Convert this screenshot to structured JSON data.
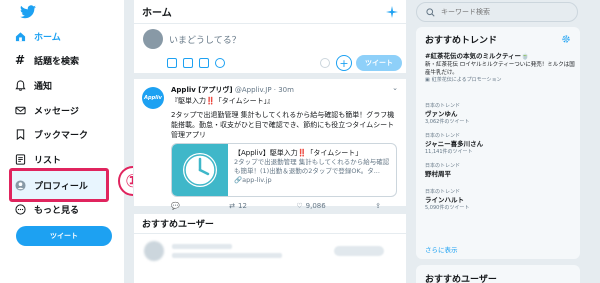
{
  "nav": {
    "items": [
      {
        "label": "ホーム",
        "icon": "home-icon"
      },
      {
        "label": "話題を検索",
        "icon": "hashtag-icon"
      },
      {
        "label": "通知",
        "icon": "bell-icon"
      },
      {
        "label": "メッセージ",
        "icon": "envelope-icon"
      },
      {
        "label": "ブックマーク",
        "icon": "bookmark-icon"
      },
      {
        "label": "リスト",
        "icon": "list-icon"
      },
      {
        "label": "プロフィール",
        "icon": "profile-icon"
      },
      {
        "label": "もっと見る",
        "icon": "more-icon"
      }
    ],
    "tweet_button": "ツイート",
    "step_badge": "①"
  },
  "timeline": {
    "title": "ホーム",
    "compose": {
      "placeholder": "いまどうしてる？",
      "tweet_button": "ツイート"
    },
    "tweet": {
      "avatar_text": "Appliv",
      "name": "Appliv [アプリヴ]",
      "handle": "@Appliv.JP · 30m",
      "title": "『駆単入力‼️「タイムシート」』",
      "body": "2タップで出退勤管理 集計もしてくれるから給与確認も簡単！グラフ機能搭載。勤怠・収支がひと目で確認でき、節約にも役立つタイムシート管理アプリ",
      "card_title": "【Appliv】駆単入力‼️「タイムシート」",
      "card_desc": "2タップで出退勤管理 集計もしてくれるから給与確認も簡単！(1)出勤＆退勤の2タップで登録OK。タ...",
      "card_url": "app-liv.jp",
      "retweets": "12",
      "likes": "9,086"
    },
    "recommended_title": "おすすめユーザー"
  },
  "right": {
    "search_placeholder": "キーワード検索",
    "trends_title": "おすすめトレンド",
    "trends": [
      {
        "name": "#紅茶花伝の本気のミルクティー🍵",
        "desc": "新・紅茶花伝 ロイヤルミルクティーついに発売！ミルクは国産牛乳だけ。",
        "promo": "紅茶花伝によるプロモーション"
      },
      {
        "context": "日本のトレンド",
        "name": "ヴァンゆん",
        "count": "3,062件のツイート"
      },
      {
        "context": "日本のトレンド",
        "name": "ジャニー喜多川さん",
        "count": "11,141件のツイート"
      },
      {
        "context": "日本のトレンド",
        "name": "野村周平"
      },
      {
        "context": "日本のトレンド",
        "name": "ラインハルト",
        "count": "5,090件のツイート"
      }
    ],
    "show_more": "さらに表示",
    "recommended_title": "おすすめユーザー"
  },
  "colors": {
    "accent": "#1da1f2",
    "highlight": "#e0245e"
  }
}
